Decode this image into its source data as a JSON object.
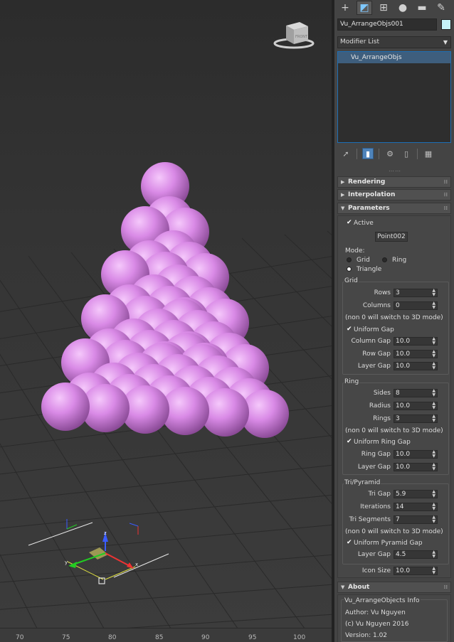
{
  "viewport": {
    "timeline_ticks": [
      "70",
      "75",
      "80",
      "85",
      "90",
      "95",
      "100"
    ],
    "viewcube_label": "FRONT",
    "sphere_color": "#d98ae6"
  },
  "panel": {
    "tabs": [
      {
        "name": "create-tab-icon",
        "glyph": "+"
      },
      {
        "name": "modify-tab-icon",
        "glyph": "◩"
      },
      {
        "name": "hierarchy-tab-icon",
        "glyph": "⊞"
      },
      {
        "name": "motion-tab-icon",
        "glyph": "●"
      },
      {
        "name": "display-tab-icon",
        "glyph": "▬"
      },
      {
        "name": "utilities-tab-icon",
        "glyph": "✎"
      }
    ],
    "object_name": "Vu_ArrangeObjs001",
    "object_color": "#c4f2f8",
    "modifier_list": "Modifier List",
    "stack_items": [
      "Vu_ArrangeObjs"
    ],
    "rollouts": {
      "rendering": "Rendering",
      "interpolation": "Interpolation",
      "parameters": "Parameters",
      "about": "About"
    },
    "params": {
      "active_label": "Active",
      "target_button": "Point002",
      "mode_label": "Mode:",
      "mode_grid": "Grid",
      "mode_ring": "Ring",
      "mode_triangle": "Triangle",
      "grid_group": "Grid",
      "rows_label": "Rows",
      "rows_value": "3",
      "columns_label": "Columns",
      "columns_value": "0",
      "grid_note": "(non 0 will switch to 3D mode)",
      "uniform_gap": "Uniform Gap",
      "column_gap_label": "Column Gap",
      "column_gap_value": "10.0",
      "row_gap_label": "Row Gap",
      "row_gap_value": "10.0",
      "layer_gap_label": "Layer Gap",
      "layer_gap_value": "10.0",
      "ring_group": "Ring",
      "sides_label": "Sides",
      "sides_value": "8",
      "radius_label": "Radius",
      "radius_value": "10.0",
      "rings_label": "Rings",
      "rings_value": "3",
      "ring_note": "(non 0 will switch to 3D mode)",
      "uniform_ring_gap": "Uniform Ring Gap",
      "ring_gap_label": "Ring Gap",
      "ring_gap_value": "10.0",
      "ring_layer_gap_label": "Layer Gap",
      "ring_layer_gap_value": "10.0",
      "tri_group": "Tri/Pyramid",
      "tri_gap_label": "Tri Gap",
      "tri_gap_value": "5.9",
      "iterations_label": "Iterations",
      "iterations_value": "14",
      "tri_segments_label": "Tri Segments",
      "tri_segments_value": "7",
      "tri_note": "(non 0 will switch to 3D mode)",
      "uniform_pyramid_gap": "Uniform Pyramid Gap",
      "tri_layer_gap_label": "Layer Gap",
      "tri_layer_gap_value": "4.5",
      "icon_size_label": "Icon Size",
      "icon_size_value": "10.0"
    },
    "about": {
      "info_title": "Vu_ArrangeObjects Info",
      "author": "Author: Vu Nguyen",
      "copyright": "(c) Vu Nguyen 2016",
      "version": "Version: 1.02"
    }
  }
}
